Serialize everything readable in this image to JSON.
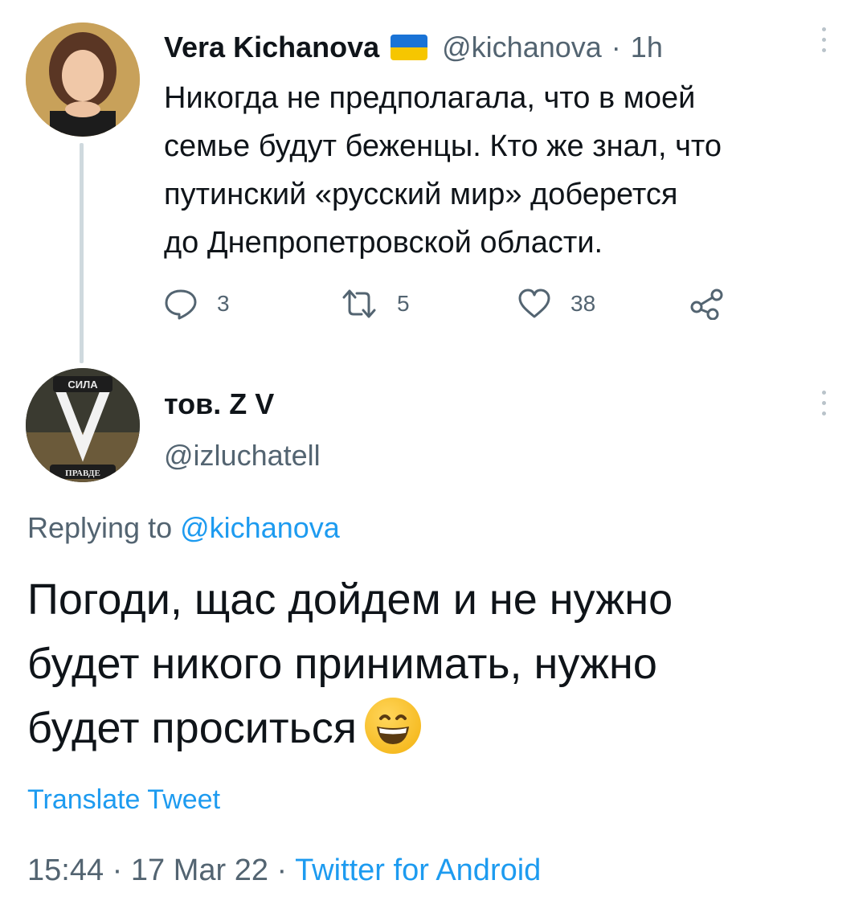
{
  "parent_tweet": {
    "author_name": "Vera Kichanova",
    "handle": "@kichanova",
    "separator": "·",
    "time": "1h",
    "text_lines": [
      "Никогда не предполагала, что в моей",
      "семье будут беженцы. Кто же знал, что",
      "путинский «русский мир» доберется",
      "до Днепропетровской области."
    ],
    "actions": {
      "replies": "3",
      "retweets": "5",
      "likes": "38"
    }
  },
  "reply_tweet": {
    "author_name": "тов. Z V",
    "handle": "@izluchatell",
    "avatar_text": {
      "top": "СИЛА",
      "bottom": "ПРАВДЕ"
    },
    "replying_to_label": "Replying to",
    "replying_to_handle": "@kichanova",
    "text_lines": [
      "Погоди, щас дойдем и не нужно",
      "будет никого принимать, нужно",
      "будет проситься"
    ],
    "translate_label": "Translate Tweet",
    "time": "15:44",
    "date": "17 Mar 22",
    "separator": "·",
    "source": "Twitter for Android"
  },
  "colors": {
    "accent": "#1d9bf0",
    "secondary_text": "#536471",
    "primary_text": "#0f1419",
    "flag_blue": "#1a73d6",
    "flag_yellow": "#f6c600"
  }
}
